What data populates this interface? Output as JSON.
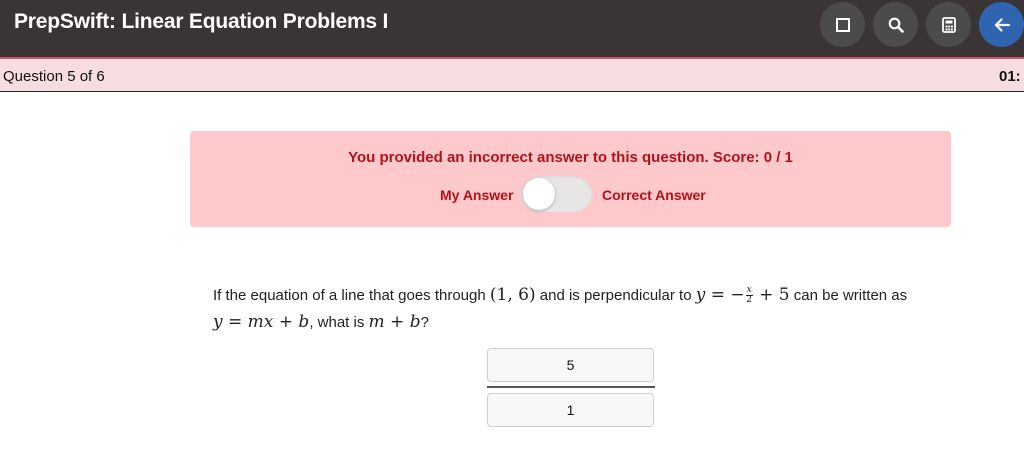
{
  "header": {
    "title": "PrepSwift: Linear Equation Problems I",
    "buttons": [
      {
        "icon": "square-icon"
      },
      {
        "icon": "search-icon"
      },
      {
        "icon": "calculator-icon"
      },
      {
        "icon": "arrow-left-icon"
      }
    ],
    "colors": {
      "bar": "#3a3534",
      "accent_line": "#c8566b",
      "back_button": "#2f65b0"
    }
  },
  "status_bar": {
    "question_count": "Question 5 of 6",
    "timer": "01:"
  },
  "feedback": {
    "message": "You provided an incorrect answer to this question. Score: 0 / 1",
    "toggle_left_label": "My Answer",
    "toggle_right_label": "Correct Answer",
    "toggle_state": "my-answer",
    "colors": {
      "background": "#fdc9ca",
      "text": "#b3121a"
    }
  },
  "question": {
    "text_1": "If the equation of a line that goes through",
    "point": "(1, 6)",
    "text_2": "and is perpendicular to",
    "eq_lhs": "y",
    "eq_eq": "=",
    "eq_minus": "−",
    "frac_num": "x",
    "frac_den": "2",
    "eq_tail": "+ 5",
    "text_3": "can be written as",
    "form_y": "y",
    "form_rhs": "= mx + b",
    "text_4": ", what is",
    "ask": "m + b",
    "ask_end": "?"
  },
  "answer": {
    "numerator": "5",
    "denominator": "1"
  }
}
